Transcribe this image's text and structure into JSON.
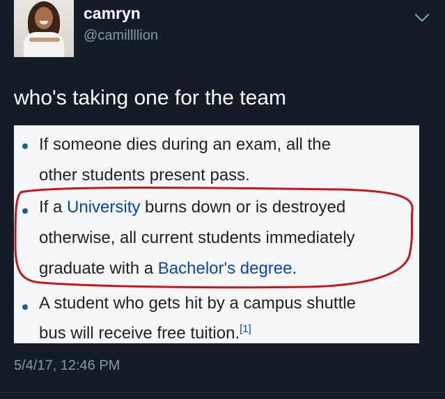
{
  "user": {
    "name": "camryn",
    "handle": "@camillllion"
  },
  "icons": {
    "avatar": "profile-photo",
    "menu": "chevron-down-icon"
  },
  "tweet": {
    "text": "who's taking one for the team",
    "timestamp": "5/4/17, 12:46 PM"
  },
  "quote": {
    "items": [
      {
        "lines": [
          "If someone dies during an exam, all the",
          "other students present pass."
        ]
      },
      {
        "line1_pre": "If a ",
        "line1_link": "University",
        "line1_post": " burns down or is destroyed",
        "line2": "otherwise, all current students immediately",
        "line3_pre": "graduate with a ",
        "line3_link": "Bachelor's degree",
        "line3_post": "."
      },
      {
        "line1": "A student who gets hit by a campus shuttle",
        "line2": "bus will receive free tuition.",
        "citation": "[1]"
      }
    ]
  },
  "colors": {
    "background": "#141d26",
    "link": "#0645ad",
    "highlight_circle": "#c4161c"
  }
}
